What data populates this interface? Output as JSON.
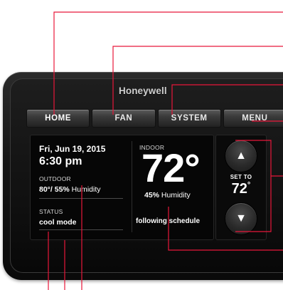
{
  "brand": "Honeywell",
  "menu_tabs": [
    {
      "label": "HOME"
    },
    {
      "label": "FAN"
    },
    {
      "label": "SYSTEM"
    },
    {
      "label": "MENU"
    }
  ],
  "home": {
    "date": "Fri, Jun 19, 2015",
    "time": "6:30 pm",
    "outdoor": {
      "label": "OUTDOOR",
      "temperature": "80°",
      "humidity": "/ 55%",
      "humidity_label": " Humidity"
    },
    "status": {
      "label": "STATUS",
      "value": "cool mode"
    },
    "indoor": {
      "label": "INDOOR",
      "temperature": "72°",
      "humidity": "45%",
      "humidity_label": " Humidity"
    },
    "schedule": "following schedule"
  },
  "setpoint": {
    "label": "SET TO",
    "value": "72",
    "degree": "°",
    "up_icon": "triangle-up-icon",
    "down_icon": "triangle-down-icon"
  },
  "colors": {
    "callout_line": "#e8173a",
    "bezel": "#141414",
    "screen": "#060606"
  }
}
